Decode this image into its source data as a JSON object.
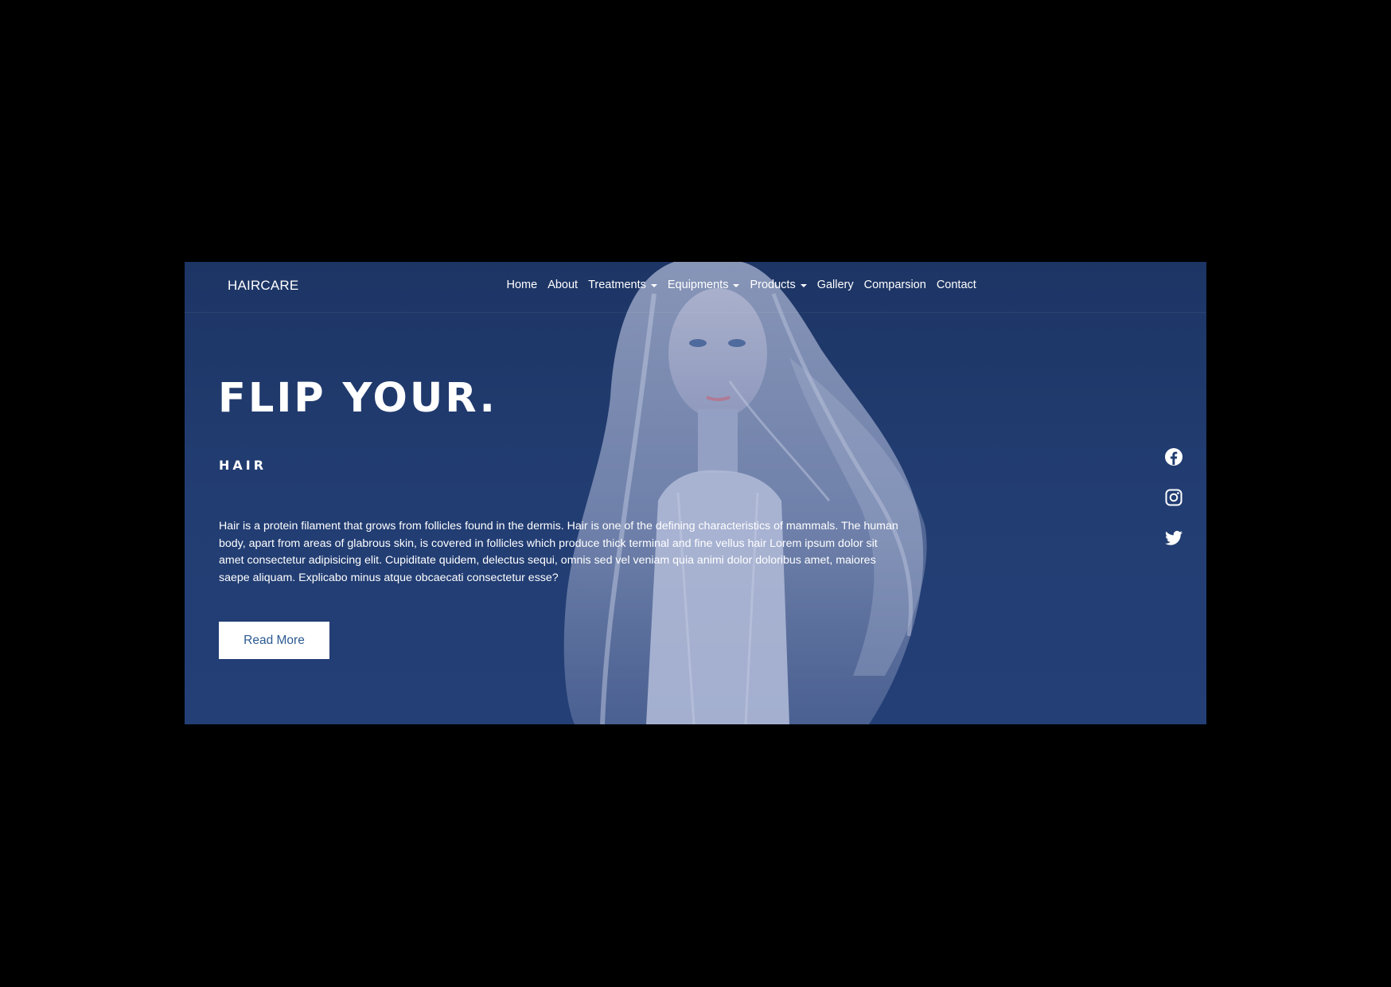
{
  "brand": "HAIRCARE",
  "nav": {
    "items": [
      {
        "label": "Home",
        "dropdown": false
      },
      {
        "label": "About",
        "dropdown": false
      },
      {
        "label": "Treatments",
        "dropdown": true
      },
      {
        "label": "Equipments",
        "dropdown": true
      },
      {
        "label": "Products",
        "dropdown": true
      },
      {
        "label": "Gallery",
        "dropdown": false
      },
      {
        "label": "Comparsion",
        "dropdown": false
      },
      {
        "label": "Contact",
        "dropdown": false
      }
    ]
  },
  "hero": {
    "title": "FLIP YOUR.",
    "subtitle": "HAIR",
    "description": "Hair is a protein filament that grows from follicles found in the dermis. Hair is one of the defining characteristics of mammals. The human body, apart from areas of glabrous skin, is covered in follicles which produce thick terminal and fine vellus hair Lorem ipsum dolor sit amet consectetur adipisicing elit. Cupiditate quidem, delectus sequi, omnis sed vel veniam quia animi dolor doloribus amet, maiores saepe aliquam. Explicabo minus atque obcaecati consectetur esse?",
    "button_label": "Read More"
  },
  "social": [
    "facebook-icon",
    "instagram-icon",
    "twitter-icon"
  ],
  "colors": {
    "page_background": "#000000",
    "hero_overlay": "#1f3a6e",
    "text": "#ffffff",
    "button_background": "#ffffff",
    "button_text": "#2b5a92"
  }
}
